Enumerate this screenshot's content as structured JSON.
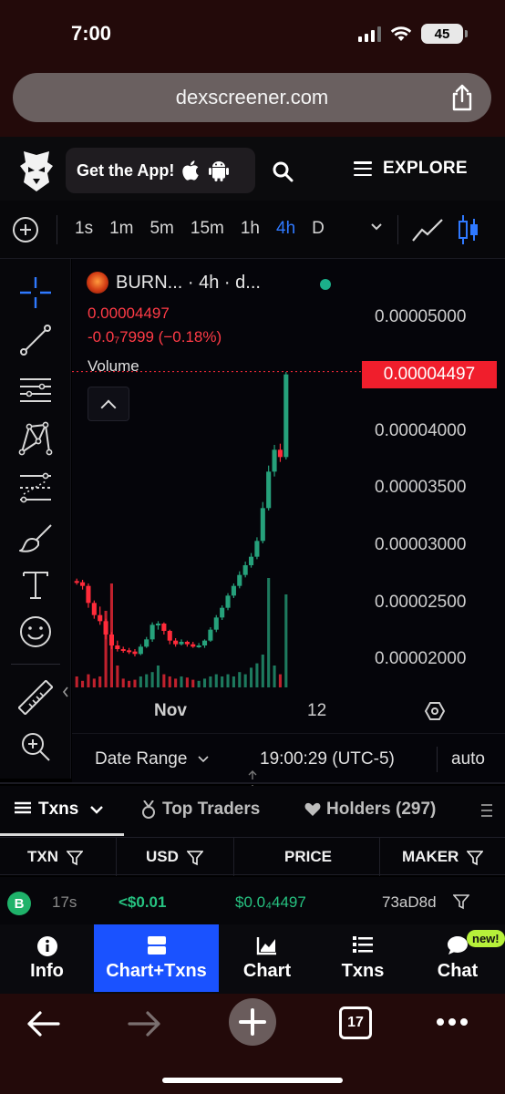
{
  "status_bar": {
    "time": "7:00",
    "battery": "45"
  },
  "browser": {
    "url": "dexscreener.com"
  },
  "header": {
    "get_app_label": "Get the App!",
    "explore_label": "EXPLORE"
  },
  "toolbar": {
    "timeframes": [
      "1s",
      "1m",
      "5m",
      "15m",
      "1h",
      "4h",
      "D"
    ],
    "active_timeframe": "4h"
  },
  "chart": {
    "legend": "BURN... · 4h · d...",
    "price": "0.00004497",
    "change": "-0.0₇7999 (−0.18%)",
    "volume_label": "Volume",
    "current_price_tag": "0.00004497",
    "y_ticks": [
      "0.00005000",
      "0.00004000",
      "0.00003500",
      "0.00003000",
      "0.00002500",
      "0.00002000"
    ],
    "x_ticks": [
      "Nov",
      "12"
    ],
    "date_range_label": "Date Range",
    "time_label": "19:00:29 (UTC-5)",
    "scale_label": "auto"
  },
  "chart_data": {
    "type": "candlestick",
    "title": "",
    "ylim": [
      1.85e-05,
      5.45e-05
    ],
    "up_color": "#26a17b",
    "down_color": "#ff2b3a",
    "candles": [
      {
        "o": 2.8e-05,
        "c": 2.79e-05,
        "h": 2.82e-05,
        "l": 2.77e-05,
        "v": 0.1
      },
      {
        "o": 2.79e-05,
        "c": 2.76e-05,
        "h": 2.81e-05,
        "l": 2.73e-05,
        "v": 0.06
      },
      {
        "o": 2.76e-05,
        "c": 2.62e-05,
        "h": 2.78e-05,
        "l": 2.58e-05,
        "v": 0.12
      },
      {
        "o": 2.62e-05,
        "c": 2.52e-05,
        "h": 2.64e-05,
        "l": 2.49e-05,
        "v": 0.08
      },
      {
        "o": 2.52e-05,
        "c": 2.47e-05,
        "h": 2.59e-05,
        "l": 2.44e-05,
        "v": 0.1
      },
      {
        "o": 2.47e-05,
        "c": 2.36e-05,
        "h": 2.49e-05,
        "l": 2.32e-05,
        "v": 0.7
      },
      {
        "o": 2.36e-05,
        "c": 2.27e-05,
        "h": 2.38e-05,
        "l": 2.24e-05,
        "v": 0.95
      },
      {
        "o": 2.27e-05,
        "c": 2.24e-05,
        "h": 2.31e-05,
        "l": 2.22e-05,
        "v": 0.2
      },
      {
        "o": 2.24e-05,
        "c": 2.23e-05,
        "h": 2.26e-05,
        "l": 2.21e-05,
        "v": 0.08
      },
      {
        "o": 2.23e-05,
        "c": 2.22e-05,
        "h": 2.25e-05,
        "l": 2.2e-05,
        "v": 0.06
      },
      {
        "o": 2.22e-05,
        "c": 2.2e-05,
        "h": 2.24e-05,
        "l": 2.18e-05,
        "v": 0.07
      },
      {
        "o": 2.2e-05,
        "c": 2.26e-05,
        "h": 2.28e-05,
        "l": 2.19e-05,
        "v": 0.1
      },
      {
        "o": 2.26e-05,
        "c": 2.32e-05,
        "h": 2.34e-05,
        "l": 2.25e-05,
        "v": 0.12
      },
      {
        "o": 2.32e-05,
        "c": 2.44e-05,
        "h": 2.46e-05,
        "l": 2.3e-05,
        "v": 0.14
      },
      {
        "o": 2.44e-05,
        "c": 2.45e-05,
        "h": 2.47e-05,
        "l": 2.4e-05,
        "v": 0.2
      },
      {
        "o": 2.45e-05,
        "c": 2.39e-05,
        "h": 2.46e-05,
        "l": 2.36e-05,
        "v": 0.12
      },
      {
        "o": 2.39e-05,
        "c": 2.31e-05,
        "h": 2.4e-05,
        "l": 2.28e-05,
        "v": 0.1
      },
      {
        "o": 2.31e-05,
        "c": 2.28e-05,
        "h": 2.33e-05,
        "l": 2.26e-05,
        "v": 0.08
      },
      {
        "o": 2.28e-05,
        "c": 2.3e-05,
        "h": 2.32e-05,
        "l": 2.27e-05,
        "v": 0.1
      },
      {
        "o": 2.3e-05,
        "c": 2.28e-05,
        "h": 2.31e-05,
        "l": 2.26e-05,
        "v": 0.09
      },
      {
        "o": 2.28e-05,
        "c": 2.26e-05,
        "h": 2.3e-05,
        "l": 2.25e-05,
        "v": 0.07
      },
      {
        "o": 2.26e-05,
        "c": 2.27e-05,
        "h": 2.29e-05,
        "l": 2.25e-05,
        "v": 0.06
      },
      {
        "o": 2.27e-05,
        "c": 2.31e-05,
        "h": 2.32e-05,
        "l": 2.25e-05,
        "v": 0.08
      },
      {
        "o": 2.31e-05,
        "c": 2.4e-05,
        "h": 2.42e-05,
        "l": 2.3e-05,
        "v": 0.1
      },
      {
        "o": 2.4e-05,
        "c": 2.5e-05,
        "h": 2.52e-05,
        "l": 2.38e-05,
        "v": 0.12
      },
      {
        "o": 2.5e-05,
        "c": 2.58e-05,
        "h": 2.6e-05,
        "l": 2.48e-05,
        "v": 0.1
      },
      {
        "o": 2.58e-05,
        "c": 2.68e-05,
        "h": 2.7e-05,
        "l": 2.56e-05,
        "v": 0.12
      },
      {
        "o": 2.68e-05,
        "c": 2.76e-05,
        "h": 2.78e-05,
        "l": 2.66e-05,
        "v": 0.1
      },
      {
        "o": 2.76e-05,
        "c": 2.85e-05,
        "h": 2.88e-05,
        "l": 2.74e-05,
        "v": 0.14
      },
      {
        "o": 2.85e-05,
        "c": 2.93e-05,
        "h": 2.96e-05,
        "l": 2.83e-05,
        "v": 0.12
      },
      {
        "o": 2.93e-05,
        "c": 3e-05,
        "h": 3.03e-05,
        "l": 2.91e-05,
        "v": 0.18
      },
      {
        "o": 3e-05,
        "c": 3.13e-05,
        "h": 3.16e-05,
        "l": 2.98e-05,
        "v": 0.22
      },
      {
        "o": 3.13e-05,
        "c": 3.4e-05,
        "h": 3.45e-05,
        "l": 3.11e-05,
        "v": 0.3
      },
      {
        "o": 3.4e-05,
        "c": 3.7e-05,
        "h": 3.75e-05,
        "l": 3.38e-05,
        "v": 1.0
      },
      {
        "o": 3.7e-05,
        "c": 3.88e-05,
        "h": 3.92e-05,
        "l": 3.66e-05,
        "v": 0.2
      },
      {
        "o": 3.88e-05,
        "c": 3.82e-05,
        "h": 3.93e-05,
        "l": 3.78e-05,
        "v": 0.12
      },
      {
        "o": 3.82e-05,
        "c": 4.5e-05,
        "h": 4.52e-05,
        "l": 3.8e-05,
        "v": 0.85
      }
    ]
  },
  "tabs": {
    "txns": "Txns",
    "top_traders": "Top Traders",
    "holders": "Holders (297)"
  },
  "table": {
    "headers": [
      "TXN",
      "USD",
      "PRICE",
      "MAKER"
    ],
    "row": {
      "type": "B",
      "age": "17s",
      "usd": "<$0.01",
      "price": "$0.0₄4497",
      "maker": "73aD8d"
    }
  },
  "bottom_nav": {
    "items": [
      "Info",
      "Chart+Txns",
      "Chart",
      "Txns",
      "Chat"
    ],
    "active": "Chart+Txns",
    "new_badge": "new!"
  },
  "safari_toolbar": {
    "tab_count": "17"
  },
  "colors": {
    "accent": "#1a52ff",
    "up": "#26a17b",
    "down": "#ff2b3a",
    "chrome": "#230a0a"
  }
}
